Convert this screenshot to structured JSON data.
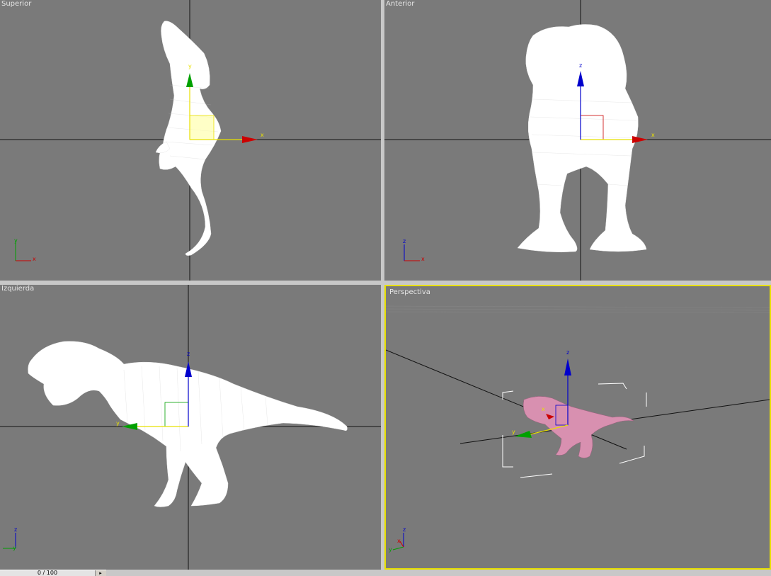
{
  "viewports": {
    "top": {
      "label": "Superior",
      "gizmo_axes": [
        "x",
        "y"
      ],
      "triad_axes": [
        "y",
        "x"
      ]
    },
    "front": {
      "label": "Anterior",
      "gizmo_axes": [
        "z",
        "x"
      ],
      "triad_axes": [
        "z",
        "x"
      ]
    },
    "left": {
      "label": "Izquierda",
      "gizmo_axes": [
        "z",
        "y"
      ],
      "triad_axes": [
        "z",
        "y"
      ]
    },
    "perspective": {
      "label": "Perspectiva",
      "active": true,
      "gizmo_axes": [
        "z",
        "y",
        "x"
      ],
      "triad_axes": [
        "z",
        "y",
        "x"
      ]
    }
  },
  "time_slider": {
    "value": "0 / 100",
    "next_icon": "chevron-right-icon"
  },
  "colors": {
    "viewport_bg": "#7a7a7a",
    "active_border": "#e8e000",
    "mesh": "#ffffff",
    "axis_x": "#cc0000",
    "axis_y": "#00a000",
    "axis_z": "#0000cc",
    "model_shaded": "#d890b0"
  }
}
